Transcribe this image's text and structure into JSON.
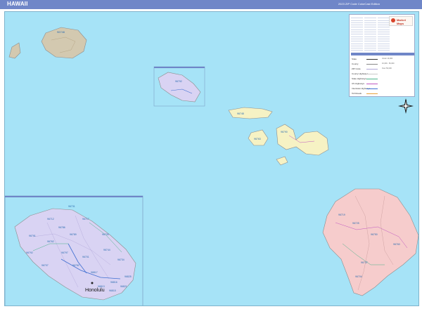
{
  "header": {
    "title": "HAWAII",
    "edition": "2023 ZIP Code ColorCast Edition"
  },
  "colors": {
    "ocean": "#a6e3f7",
    "header_bar": "#6f86c8",
    "kauai": "#d3c9b0",
    "oahu": "#d9d3f3",
    "maui_county": "#f6f2c4",
    "hawaii_island": "#f6cccc",
    "road_interstate": "#3f6fd1",
    "road_us": "#c057c0",
    "road_state": "#4bb38b"
  },
  "islands": {
    "kauai_zip": "96746",
    "oahu_inset_zip": "96792",
    "molokai_zip": "96748",
    "lanai_zip": "96763",
    "maui_zip": "96790",
    "big_island_zips": [
      "96719",
      "96725",
      "96750",
      "96760",
      "96737",
      "96704"
    ]
  },
  "oahu_detail": {
    "city": "Honolulu",
    "zips": [
      "96731",
      "96712",
      "96791",
      "96717",
      "96730",
      "96762",
      "96792",
      "96707",
      "96797",
      "96782",
      "96701",
      "96789",
      "96786",
      "96744",
      "96734",
      "96817",
      "96813",
      "96815",
      "96816",
      "96821",
      "96825"
    ]
  },
  "legend": {
    "logo": "Market Maps",
    "keys": [
      "State",
      "County",
      "ZIP Code",
      "County Highways",
      "State Highways",
      "US Highways",
      "Interstate Highways",
      "Toll Roads"
    ],
    "city_label": "City",
    "samples": [
      "Under 10,000",
      "10,000 - 50,000",
      "Over 50,000"
    ]
  },
  "compass": {
    "north": "N"
  }
}
